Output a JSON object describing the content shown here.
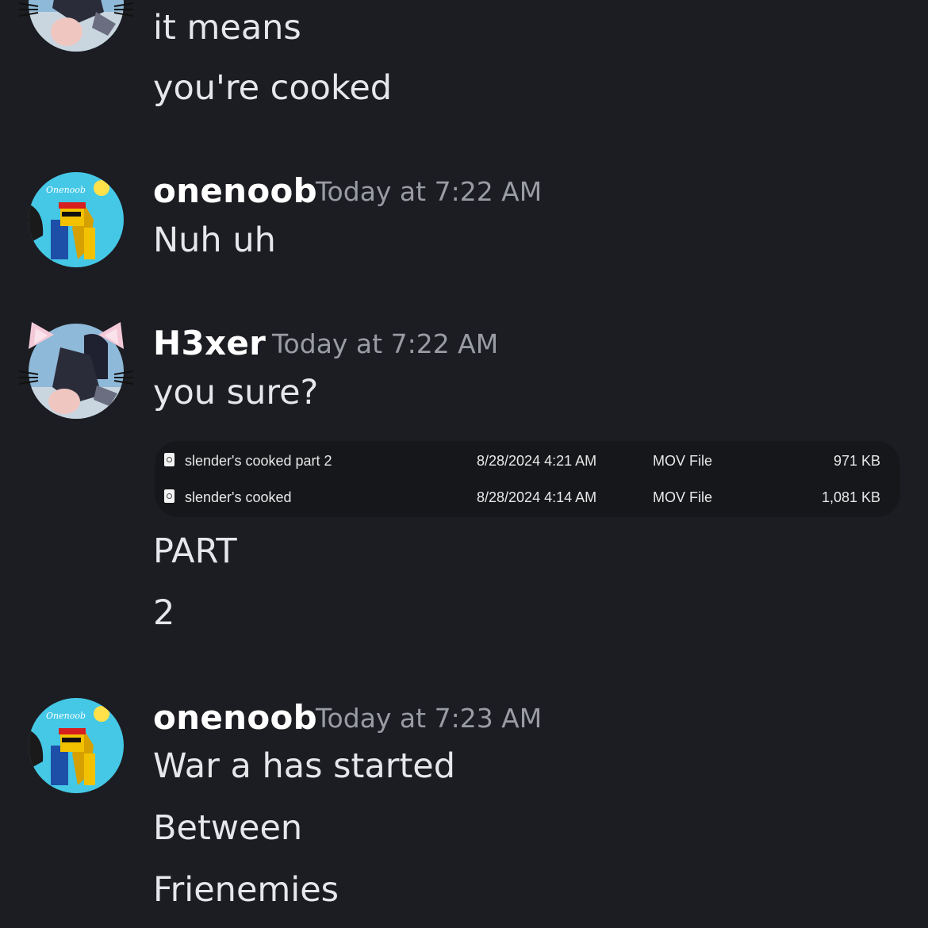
{
  "top_fragment": {
    "messages": [
      "it means",
      "you're cooked"
    ]
  },
  "posts": [
    {
      "username": "onenoob",
      "timestamp": "Today at 7:22 AM",
      "avatar": "onenoob-avatar",
      "avatar_text": "Onenoob",
      "messages": [
        "Nuh uh"
      ]
    },
    {
      "username": "H3xer",
      "timestamp": "Today at 7:22 AM",
      "avatar": "h3xer-avatar",
      "messages": [
        "you sure?"
      ],
      "attachment": {
        "files": [
          {
            "name": "slender's cooked part 2",
            "date": "8/28/2024 4:21 AM",
            "type": "MOV File",
            "size": "971 KB"
          },
          {
            "name": "slender's cooked",
            "date": "8/28/2024 4:14 AM",
            "type": "MOV File",
            "size": "1,081 KB"
          }
        ]
      },
      "after_messages": [
        "PART",
        "2"
      ]
    },
    {
      "username": "onenoob",
      "timestamp": "Today at 7:23 AM",
      "avatar": "onenoob-avatar",
      "avatar_text": "Onenoob",
      "messages": [
        "War a has started",
        "Between",
        "Frienemies"
      ]
    }
  ],
  "colors": {
    "background": "#1c1d22",
    "username": "#ffffff",
    "timestamp": "#9a9ca4",
    "message_text": "#e6e7ea",
    "file_panel": "#16171a"
  }
}
